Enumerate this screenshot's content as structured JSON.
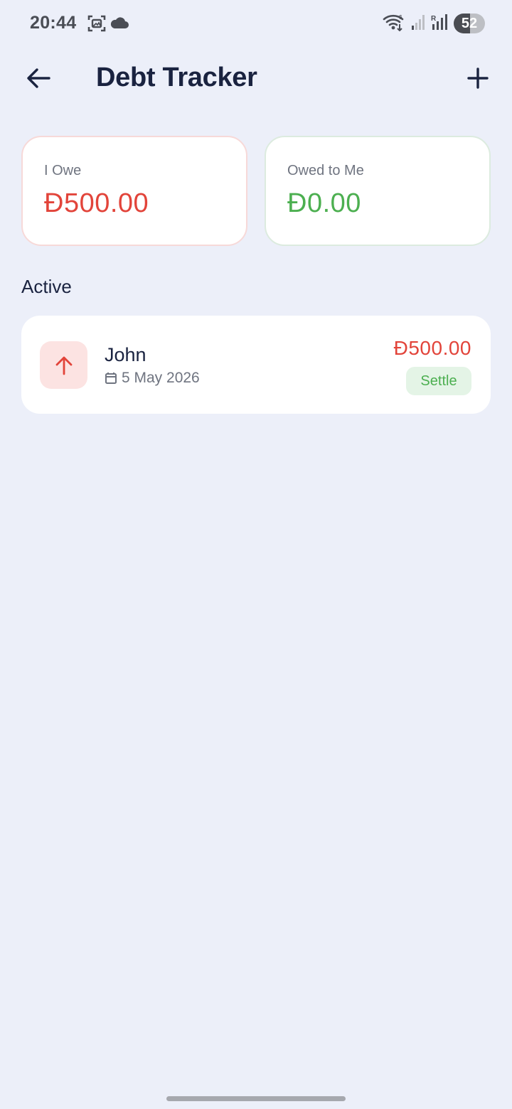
{
  "status_bar": {
    "time": "20:44",
    "battery_level": "52",
    "icons": [
      "screenshot-icon",
      "cloud-icon",
      "wifi-icon",
      "signal-icon",
      "signal-roaming-icon",
      "battery-icon"
    ]
  },
  "app_bar": {
    "title": "Debt Tracker",
    "back_icon": "arrow-left-icon",
    "add_icon": "plus-icon"
  },
  "summary": {
    "i_owe": {
      "label": "I Owe",
      "currency": "Đ",
      "amount": "500.00",
      "color": "#E2443A"
    },
    "owed_to_me": {
      "label": "Owed to Me",
      "currency": "Đ",
      "amount": "0.00",
      "color": "#4CAF50"
    }
  },
  "active_section": {
    "title": "Active",
    "items": [
      {
        "name": "John",
        "date": "5 May 2026",
        "amount": "Đ500.00",
        "direction_icon": "arrow-up-icon",
        "date_icon": "calendar-icon",
        "settle_label": "Settle"
      }
    ]
  },
  "colors": {
    "background": "#ECEFF9",
    "owe_red": "#E2443A",
    "owed_green": "#4CAF50",
    "title_navy": "#1A2340"
  }
}
